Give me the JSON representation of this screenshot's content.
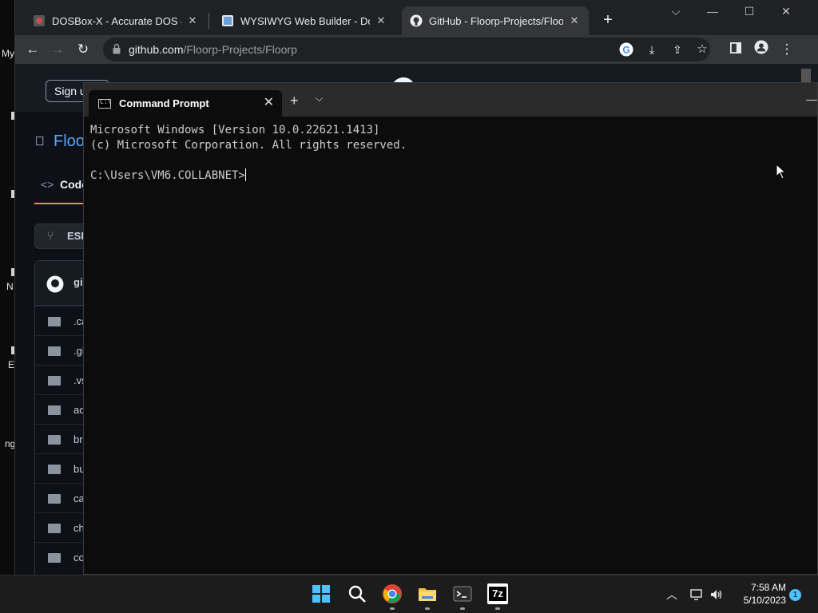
{
  "desktop": {
    "labels": [
      "My",
      "N",
      "E",
      "ng"
    ]
  },
  "browser": {
    "tabs": [
      {
        "title": "DOSBox-X - Accurate DOS emulator",
        "active": false,
        "icon": "dosbox-icon"
      },
      {
        "title": "WYSIWYG Web Builder - Download",
        "active": false,
        "icon": "wysiwyg-icon"
      },
      {
        "title": "GitHub - Floorp-Projects/Floorp",
        "active": true,
        "icon": "github-icon"
      }
    ],
    "new_tab_label": "+",
    "window_controls": {
      "chevron": "⌵",
      "minimize": "—",
      "maximize": "☐",
      "close": "✕"
    },
    "url": {
      "host": "github.com",
      "path": "/Floorp-Projects/Floorp"
    }
  },
  "github": {
    "sign_in": "Sign u",
    "repo_name": "Floo",
    "code_tab": "Code",
    "branch": "ESR",
    "header_text": "gi",
    "files": [
      ".ca",
      ".gi",
      ".vs",
      "ac",
      "br",
      "bu",
      "ca",
      "ch",
      "co"
    ]
  },
  "terminal": {
    "tab_title": "Command Prompt",
    "tab_close": "✕",
    "new_tab": "+",
    "dropdown": "⌵",
    "minimize": "—",
    "lines": [
      "Microsoft Windows [Version 10.0.22621.1413]",
      "(c) Microsoft Corporation. All rights reserved.",
      "",
      "C:\\Users\\VM6.COLLABNET>"
    ]
  },
  "taskbar": {
    "time": "7:58 AM",
    "date": "5/10/2023",
    "notification_count": "1",
    "apps": [
      "start-icon",
      "search-icon",
      "chrome-icon",
      "file-explorer-icon",
      "terminal-icon",
      "7zip-icon"
    ],
    "sevenzip_label": "7z"
  },
  "colors": {
    "accent": "#58a6ff",
    "tab_underline": "#f78166",
    "taskbar": "#1c1c1c"
  }
}
